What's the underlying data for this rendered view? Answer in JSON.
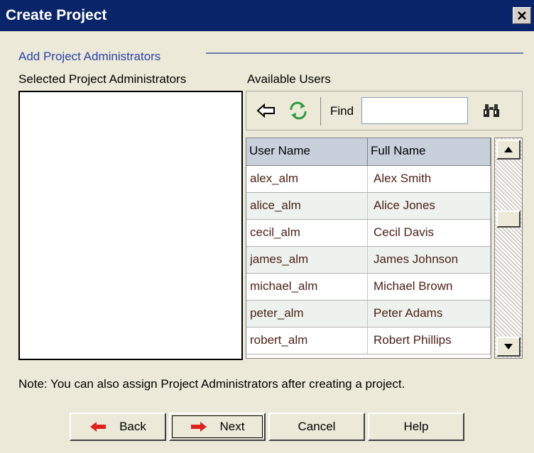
{
  "window": {
    "title": "Create Project"
  },
  "section": {
    "title": "Add Project Administrators"
  },
  "selected_panel": {
    "label": "Selected Project Administrators"
  },
  "available_panel": {
    "label": "Available Users",
    "find_label": "Find",
    "find_value": ""
  },
  "table": {
    "headers": [
      "User Name",
      "Full Name"
    ],
    "rows": [
      [
        "alex_alm",
        "Alex Smith"
      ],
      [
        "alice_alm",
        "Alice Jones"
      ],
      [
        "cecil_alm",
        "Cecil Davis"
      ],
      [
        "james_alm",
        "James Johnson"
      ],
      [
        "michael_alm",
        "Michael Brown"
      ],
      [
        "peter_alm",
        "Peter Adams"
      ],
      [
        "robert_alm",
        "Robert Phillips"
      ]
    ]
  },
  "note": "Note: You can also assign Project Administrators after creating a project.",
  "buttons": {
    "back": "Back",
    "next": "Next",
    "cancel": "Cancel",
    "help": "Help"
  },
  "icons": {
    "add": "arrow-left-icon",
    "refresh": "refresh-icon",
    "find": "binoculars-icon",
    "back": "red-arrow-left-icon",
    "next": "red-arrow-right-icon"
  },
  "colors": {
    "title_bar": "#0a246a",
    "section_title": "#2a45a8",
    "arrow_red": "#e0201c",
    "refresh_green": "#2e9a3c"
  }
}
